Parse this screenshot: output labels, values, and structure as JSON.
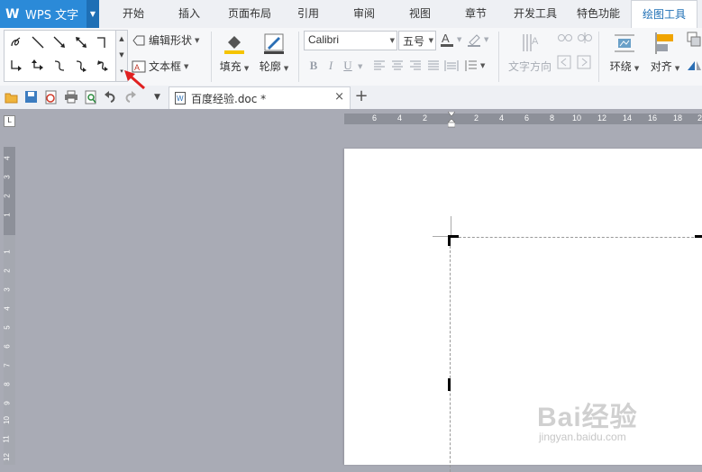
{
  "app": {
    "title": "WPS 文字",
    "logo_letter": "W"
  },
  "menu_tabs": [
    {
      "label": "开始"
    },
    {
      "label": "插入"
    },
    {
      "label": "页面布局"
    },
    {
      "label": "引用"
    },
    {
      "label": "审阅"
    },
    {
      "label": "视图"
    },
    {
      "label": "章节"
    },
    {
      "label": "开发工具"
    },
    {
      "label": "特色功能"
    },
    {
      "label": "绘图工具",
      "active": true
    }
  ],
  "ribbon": {
    "edit_shape": "编辑形状",
    "text_box": "文本框",
    "fill": "填充",
    "outline": "轮廓",
    "font_name": "Calibri",
    "font_size": "五号",
    "bold": "B",
    "italic": "I",
    "underline": "U",
    "text_direction": "文字方向",
    "wrap": "环绕",
    "align": "对齐"
  },
  "document_tab": {
    "title": "百度经验.doc *",
    "close": "×",
    "new_tab": "+"
  },
  "ruler": {
    "corner": "L",
    "horizontal_ticks": [
      "6",
      "4",
      "2",
      "2",
      "4",
      "6",
      "8",
      "10",
      "12",
      "14",
      "16",
      "18",
      "2"
    ],
    "vertical_ticks": [
      "4",
      "3",
      "2",
      "1",
      "1",
      "2",
      "3",
      "4",
      "5",
      "6",
      "7",
      "8",
      "9",
      "10",
      "11",
      "12"
    ]
  },
  "watermark": {
    "text": "Bai经验",
    "url": "jingyan.baidu.com"
  },
  "colors": {
    "brand_blue": "#2b8ad8",
    "active_tab_text": "#1e6fb5",
    "fill_icon": "#f5c400",
    "annotation_arrow": "#e02020",
    "workspace": "#a9abb5"
  },
  "icons": {
    "open": "folder-open-icon",
    "save": "save-icon",
    "export_pdf": "pdf-icon",
    "print": "print-icon",
    "print_preview": "print-preview-icon",
    "undo": "undo-icon",
    "redo": "redo-icon",
    "more": "chevron-down-icon"
  }
}
